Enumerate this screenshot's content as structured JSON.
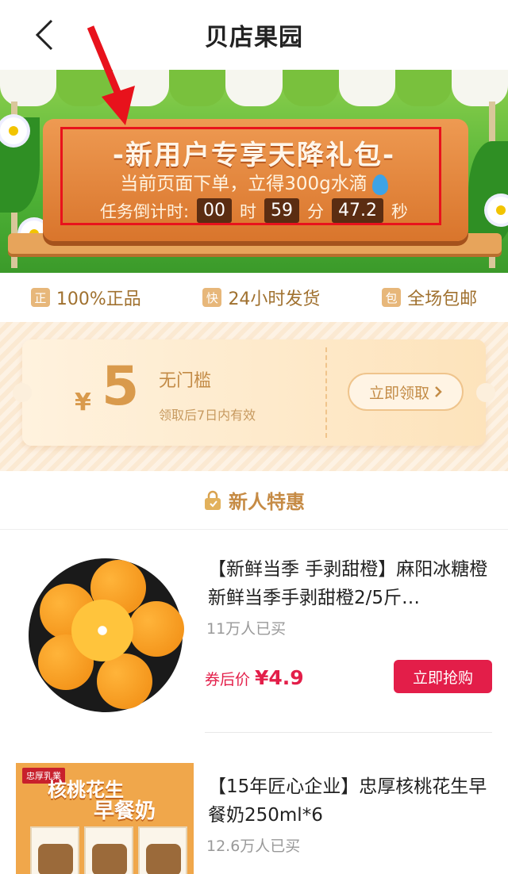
{
  "nav": {
    "title": "贝店果园",
    "back_icon": "chevron-left-icon"
  },
  "banner": {
    "headline": "-新用户专享天降礼包-",
    "subline": "当前页面下单，立得300g水滴",
    "drop_icon": "water-drop-icon",
    "countdown": {
      "label": "任务倒计时:",
      "hours": "00",
      "hours_unit": "时",
      "minutes": "59",
      "minutes_unit": "分",
      "seconds": "47.2",
      "seconds_unit": "秒"
    }
  },
  "promises": [
    {
      "badge": "正",
      "text": "100%正品"
    },
    {
      "badge": "快",
      "text": "24小时发货"
    },
    {
      "badge": "包",
      "text": "全场包邮"
    }
  ],
  "coupon": {
    "currency": "¥",
    "amount": "5",
    "name": "无门槛",
    "validity": "领取后7日内有效",
    "claim_label": "立即领取"
  },
  "section": {
    "title": "新人特惠",
    "icon": "lock-bag-icon"
  },
  "products": [
    {
      "title": "【新鲜当季 手剥甜橙】麻阳冰糖橙新鲜当季手剥甜橙2/5斤…",
      "sold": "11万人已买",
      "price_label": "券后价",
      "price": "¥4.9",
      "buy_label": "立即抢购"
    },
    {
      "title": "【15年匠心企业】忠厚核桃花生早餐奶250ml*6",
      "sold": "12.6万人已买",
      "image_text_1": "核桃花生",
      "image_text_2": "早餐奶",
      "image_brand": "忠厚乳業"
    }
  ],
  "colors": {
    "accent": "#e31e49",
    "gold": "#c68b45",
    "highlight_outline": "#e8121c"
  }
}
